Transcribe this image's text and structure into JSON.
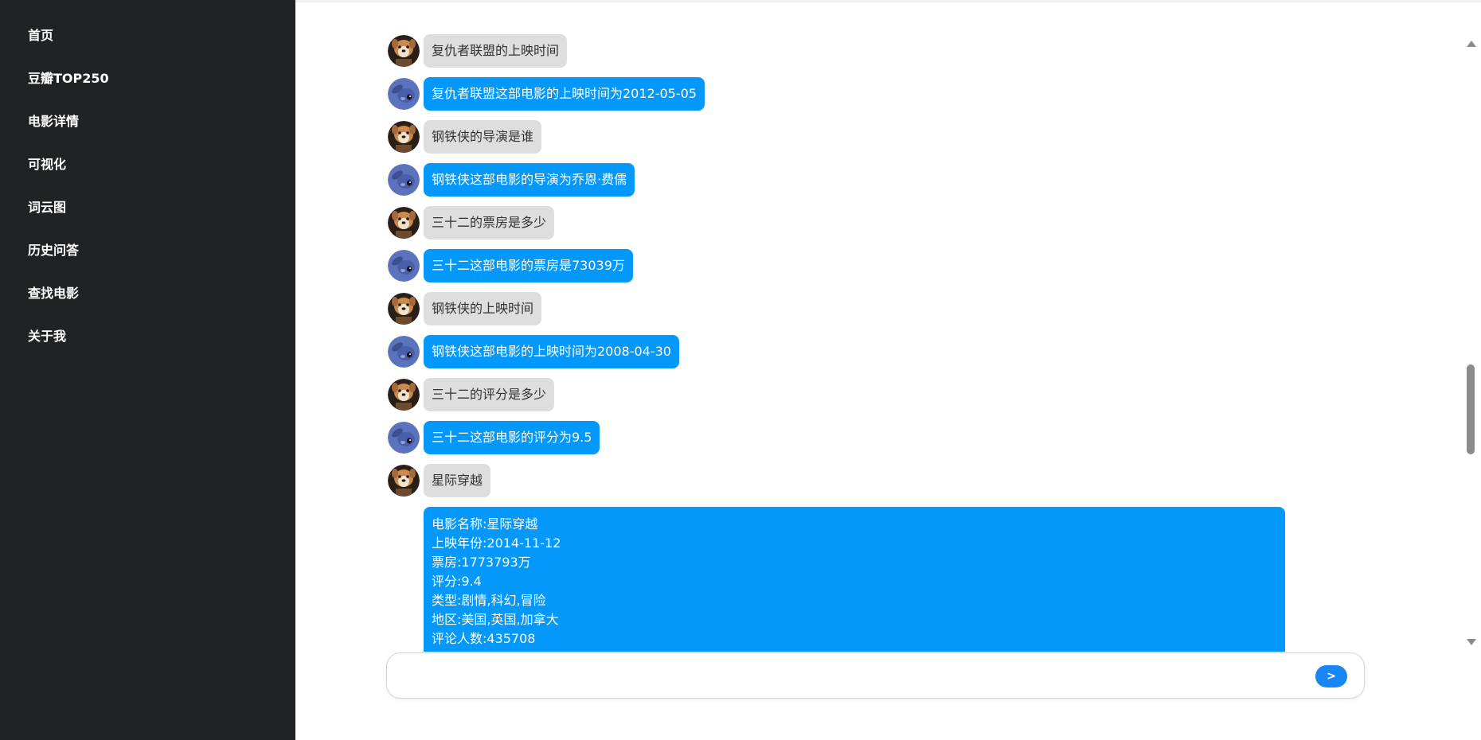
{
  "sidebar": {
    "items": [
      {
        "label": "首页"
      },
      {
        "label": "豆瓣TOP250"
      },
      {
        "label": "电影详情"
      },
      {
        "label": "可视化"
      },
      {
        "label": "词云图"
      },
      {
        "label": "历史问答"
      },
      {
        "label": "查找电影"
      },
      {
        "label": "关于我"
      }
    ]
  },
  "chat": {
    "messages": [
      {
        "role": "user",
        "avatar": "dog-avatar-icon",
        "text": "复仇者联盟的上映时间"
      },
      {
        "role": "bot",
        "avatar": "stitch-avatar-icon",
        "text": "复仇者联盟这部电影的上映时间为2012-05-05"
      },
      {
        "role": "user",
        "avatar": "dog-avatar-icon",
        "text": "钢铁侠的导演是谁"
      },
      {
        "role": "bot",
        "avatar": "stitch-avatar-icon",
        "text": "钢铁侠这部电影的导演为乔恩·费儒"
      },
      {
        "role": "user",
        "avatar": "dog-avatar-icon",
        "text": "三十二的票房是多少"
      },
      {
        "role": "bot",
        "avatar": "stitch-avatar-icon",
        "text": "三十二这部电影的票房是73039万"
      },
      {
        "role": "user",
        "avatar": "dog-avatar-icon",
        "text": "钢铁侠的上映时间"
      },
      {
        "role": "bot",
        "avatar": "stitch-avatar-icon",
        "text": "钢铁侠这部电影的上映时间为2008-04-30"
      },
      {
        "role": "user",
        "avatar": "dog-avatar-icon",
        "text": "三十二的评分是多少"
      },
      {
        "role": "bot",
        "avatar": "stitch-avatar-icon",
        "text": "三十二这部电影的评分为9.5"
      },
      {
        "role": "user",
        "avatar": "dog-avatar-icon",
        "text": "星际穿越"
      }
    ],
    "detail": {
      "lines": [
        "电影名称:星际穿越",
        "上映年份:2014-11-12",
        "票房:1773793万",
        "评分:9.4",
        "类型:剧情,科幻,冒险",
        "地区:美国,英国,加拿大",
        "评论人数:435708"
      ]
    }
  },
  "input": {
    "value": "",
    "send_label": ">"
  },
  "colors": {
    "sidebar_bg": "#212224",
    "bot_bubble": "#0498fa",
    "user_bubble": "#dedede",
    "send_button": "#1a86f5"
  }
}
